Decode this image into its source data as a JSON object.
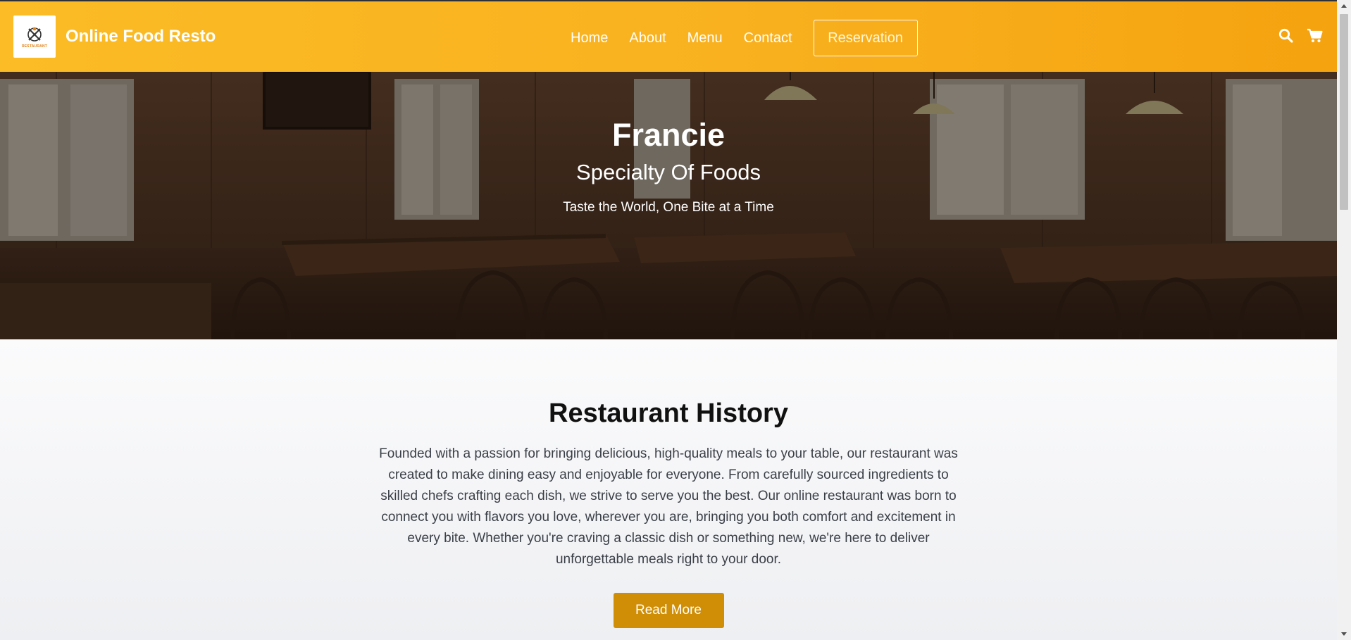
{
  "header": {
    "logo_text": "RESTAURANT",
    "brand_name": "Online Food Resto",
    "nav": [
      {
        "label": "Home"
      },
      {
        "label": "About"
      },
      {
        "label": "Menu"
      },
      {
        "label": "Contact"
      }
    ],
    "reservation_label": "Reservation",
    "icons": {
      "search": "search-icon",
      "cart": "cart-icon"
    },
    "colors": {
      "bar_start": "#fbbc25",
      "bar_end": "#f5a30f"
    }
  },
  "hero": {
    "title": "Francie",
    "subtitle": "Specialty Of Foods",
    "tagline": "Taste the World, One Bite at a Time"
  },
  "history": {
    "title": "Restaurant History",
    "body": "Founded with a passion for bringing delicious, high-quality meals to your table, our restaurant was created to make dining easy and enjoyable for everyone. From carefully sourced ingredients to skilled chefs crafting each dish, we strive to serve you the best. Our online restaurant was born to connect you with flavors you love, wherever you are, bringing you both comfort and excitement in every bite. Whether you're craving a classic dish or something new, we're here to deliver unforgettable meals right to your door.",
    "button_label": "Read More",
    "button_color": "#cf8e06"
  }
}
